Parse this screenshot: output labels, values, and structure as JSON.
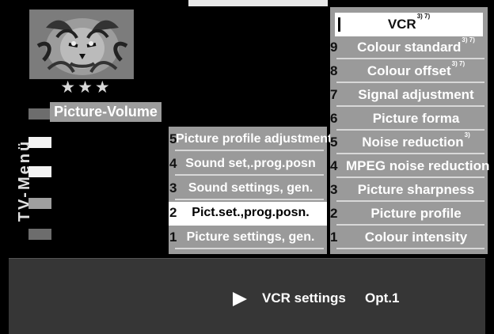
{
  "side_title": "TV-Menü",
  "header": {
    "rating_stars": "★★★",
    "volume_label": "Picture-Volume"
  },
  "middle_menu": {
    "items": [
      {
        "num": "5",
        "label": "Picture profile adjustment"
      },
      {
        "num": "4",
        "label": "Sound set,.prog.posn"
      },
      {
        "num": "3",
        "label": "Sound settings, gen."
      },
      {
        "num": "2",
        "label": "Pict.set.,prog.posn."
      },
      {
        "num": "1",
        "label": "Picture settings, gen."
      }
    ]
  },
  "right_menu": {
    "title": "VCR",
    "title_note": "3) 7)",
    "items": [
      {
        "num": "9",
        "label": "Colour  standard",
        "note": "3) 7)"
      },
      {
        "num": "8",
        "label": "Colour offset",
        "note": "3) 7)"
      },
      {
        "num": "7",
        "label": "Signal adjustment"
      },
      {
        "num": "6",
        "label": "Picture forma"
      },
      {
        "num": "5",
        "label": "Noise reduction",
        "note": "3)"
      },
      {
        "num": "4",
        "label": "MPEG noise reduction"
      },
      {
        "num": "3",
        "label": "Picture sharpness"
      },
      {
        "num": "2",
        "label": "Picture profile"
      },
      {
        "num": "1",
        "label": "Colour intensity"
      }
    ]
  },
  "footer": {
    "label": "VCR settings",
    "option": "Opt.1"
  },
  "icons": {
    "play": "play-icon",
    "tiger": "tiger-image"
  },
  "colors": {
    "background": "#000000",
    "menu_gray": "#9a9a9a",
    "footer": "#363636",
    "highlight": "#ffffff"
  }
}
